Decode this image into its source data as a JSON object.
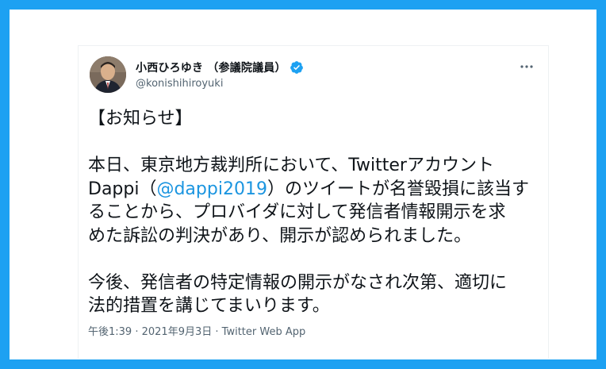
{
  "author": {
    "display_name": "小西ひろゆき （参議院議員）",
    "handle": "@konishihiroyuki",
    "verified": true
  },
  "tweet": {
    "heading": "【お知らせ】",
    "para1_a": "本日、東京地方裁判所において、Twitterアカウント",
    "para1_b_pre": "Dappi（",
    "mention": "@dappi2019",
    "para1_b_post": "）のツイートが名誉毀損に該当す",
    "para1_c": "ることから、プロバイダに対して発信者情報開示を求",
    "para1_d": "めた訴訟の判決があり、開示が認められました。",
    "para2_a": "今後、発信者の特定情報の開示がなされ次第、適切に",
    "para2_b": "法的措置を講じてまいります。"
  },
  "meta": {
    "time": "午後1:39",
    "separator1": " · ",
    "date": "2021年9月3日",
    "separator2": " · ",
    "source": "Twitter Web App"
  },
  "colors": {
    "background_border": "#1da1f2",
    "mention": "#1b95e0",
    "verified_badge": "#1da1f2"
  },
  "icons": {
    "more": "more-horizontal-icon",
    "verified": "verified-badge-icon"
  }
}
